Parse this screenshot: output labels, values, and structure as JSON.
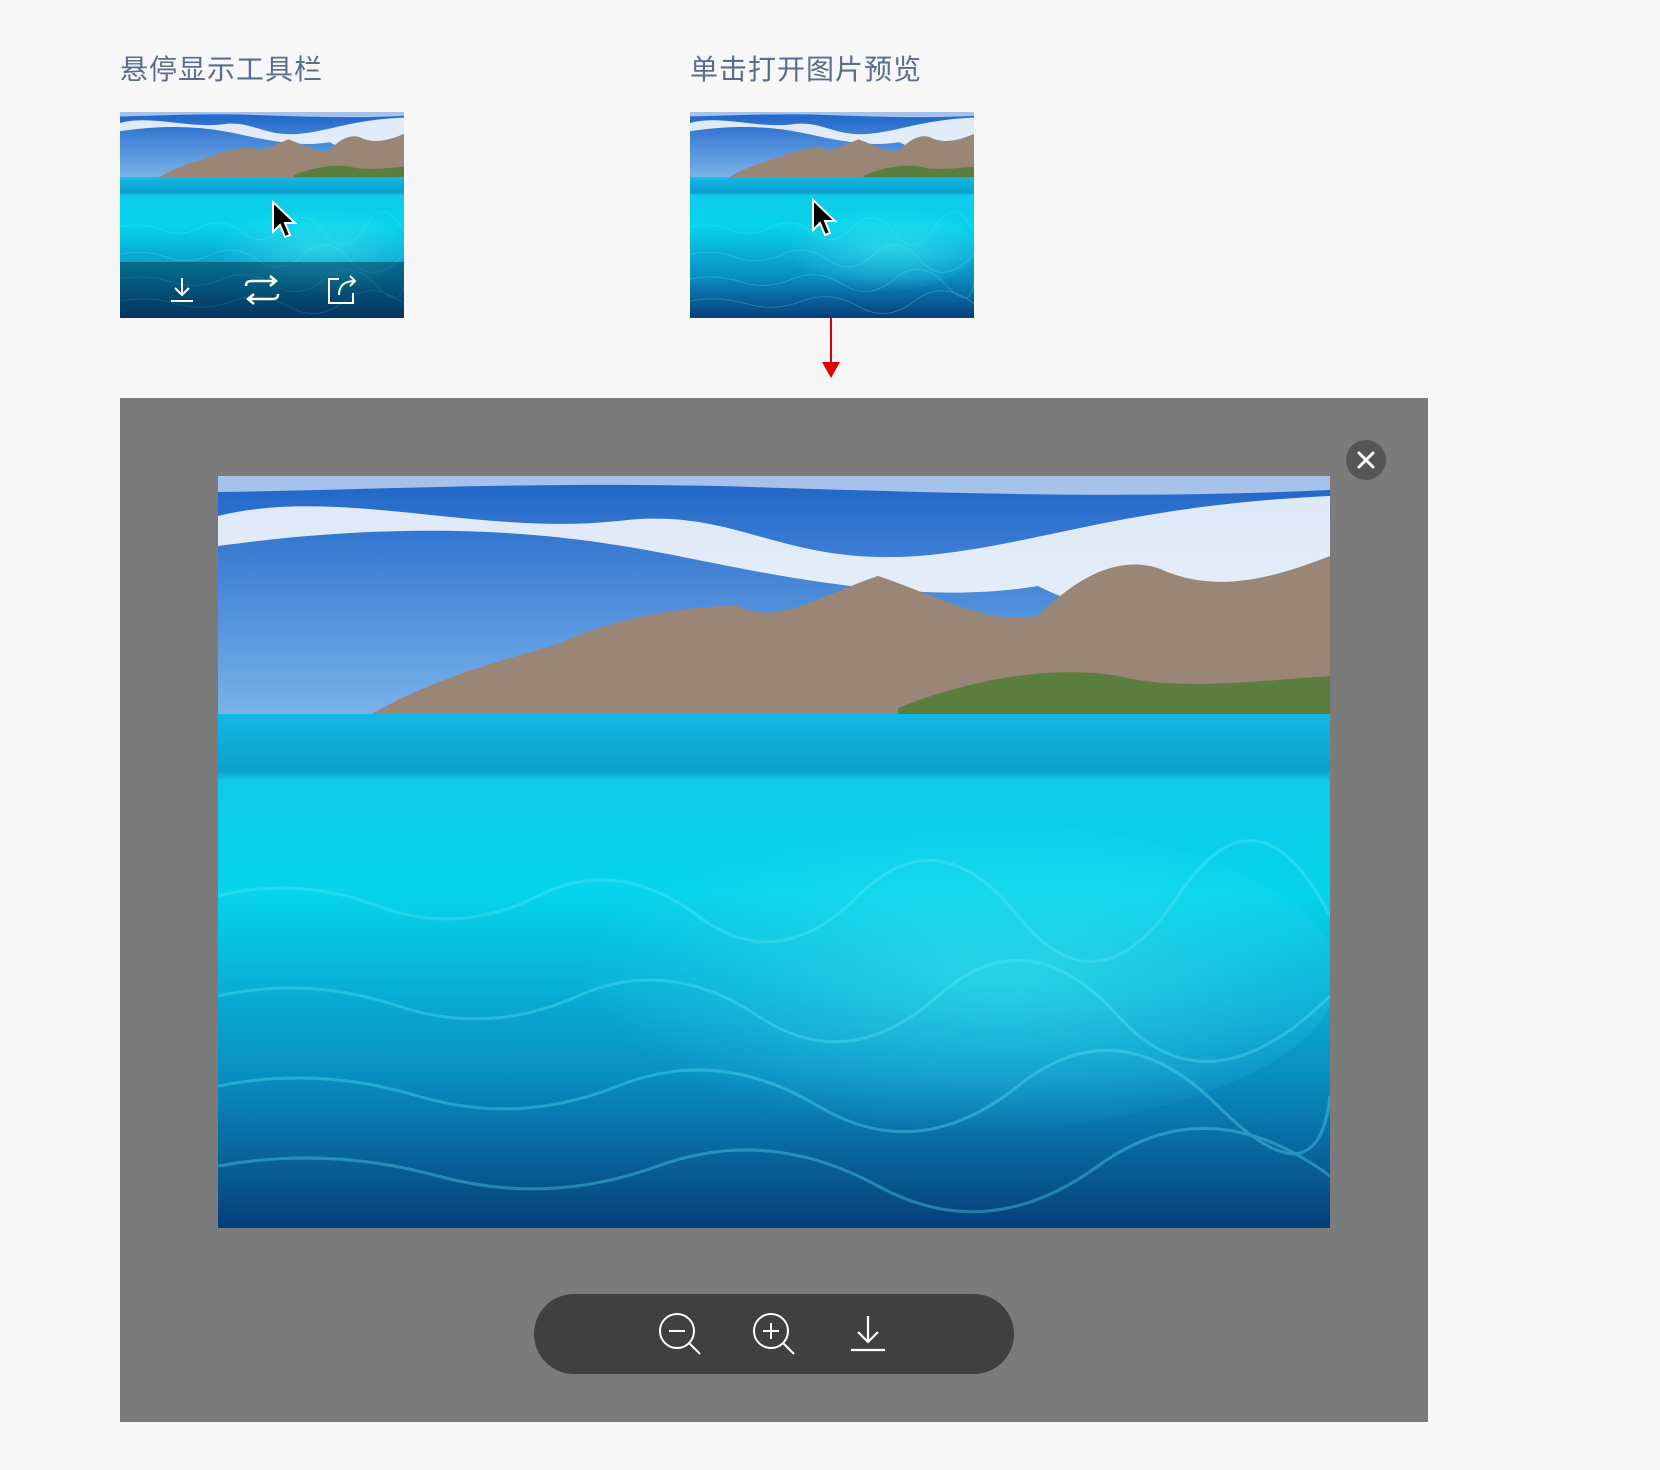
{
  "captions": {
    "hover": "悬停显示工具栏",
    "click": "单击打开图片预览"
  },
  "thumb_toolbar": {
    "icons": [
      "download-icon",
      "swap-icon",
      "share-icon"
    ]
  },
  "preview_toolbar": {
    "icons": [
      "zoom-out-icon",
      "zoom-in-icon",
      "download-icon"
    ]
  },
  "close_icon": "close-icon",
  "colors": {
    "caption": "#5a6d8e",
    "overlay": "#7b7b7b",
    "toolbar": "#404040",
    "arrow": "#e00000"
  }
}
